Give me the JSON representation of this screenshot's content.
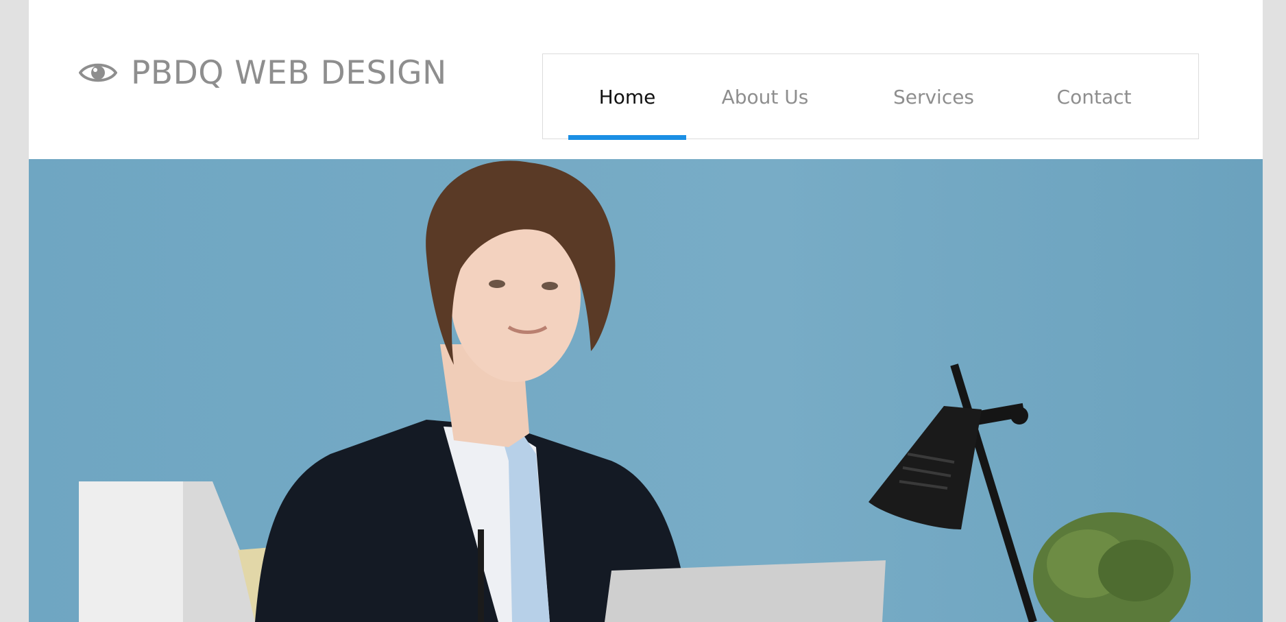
{
  "site": {
    "brand_name": "PBDQ WEB DESIGN",
    "brand_icon": "eye-icon"
  },
  "nav": {
    "items": [
      {
        "label": "Home",
        "active": true
      },
      {
        "label": "About Us",
        "active": false
      },
      {
        "label": "Services",
        "active": false
      },
      {
        "label": "Contact",
        "active": false
      }
    ]
  },
  "colors": {
    "accent": "#1b8fe4",
    "hero_background": "#74a9c3",
    "page_background": "#e1e1e1",
    "muted_text": "#8e8e8e"
  },
  "hero": {
    "image": "businessman-at-desk-photo"
  }
}
